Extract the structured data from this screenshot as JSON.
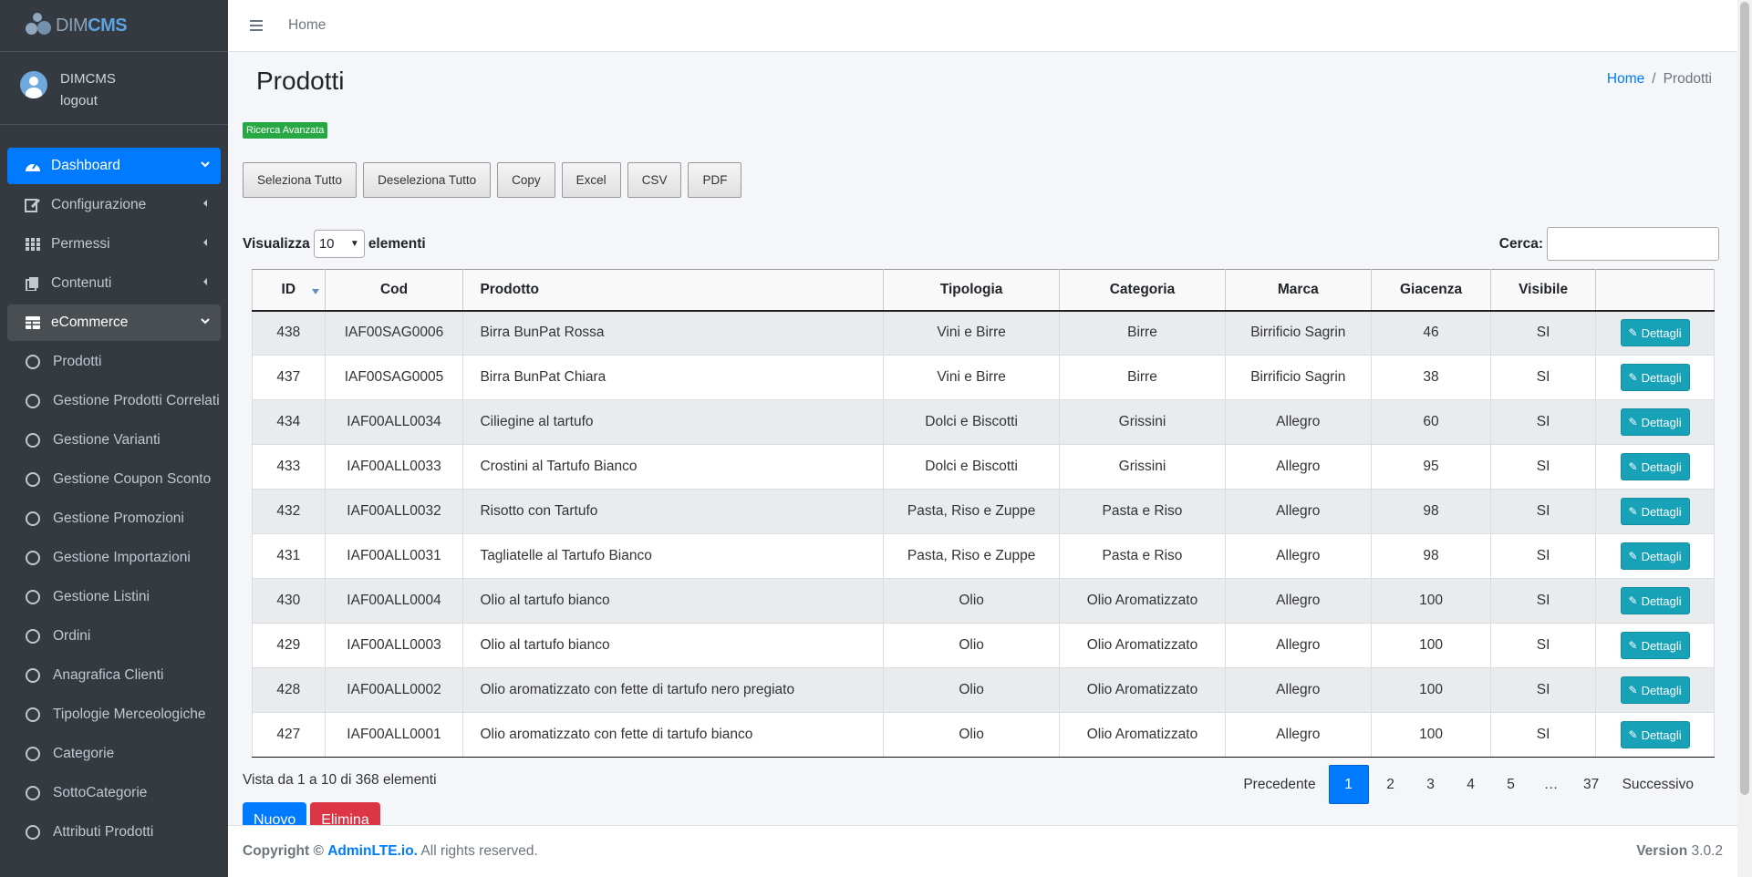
{
  "brand": {
    "dim": "DIM",
    "cms": "CMS"
  },
  "user": {
    "name": "DIMCMS",
    "logout": "logout"
  },
  "sidebar": {
    "main": [
      {
        "label": "Dashboard",
        "icon": "tachometer-icon",
        "arrow": "down",
        "state": "active"
      },
      {
        "label": "Configurazione",
        "icon": "edit-icon",
        "arrow": "left",
        "state": ""
      },
      {
        "label": "Permessi",
        "icon": "grid-icon",
        "arrow": "left",
        "state": ""
      },
      {
        "label": "Contenuti",
        "icon": "copy-icon",
        "arrow": "left",
        "state": ""
      },
      {
        "label": "eCommerce",
        "icon": "table-icon",
        "arrow": "down",
        "state": "open"
      }
    ],
    "sub": [
      "Prodotti",
      "Gestione Prodotti Correlati",
      "Gestione Varianti",
      "Gestione Coupon Sconto",
      "Gestione Promozioni",
      "Gestione Importazioni",
      "Gestione Listini",
      "Ordini",
      "Anagrafica Clienti",
      "Tipologie Merceologiche",
      "Categorie",
      "SottoCategorie",
      "Attributi Prodotti"
    ]
  },
  "topbar": {
    "home": "Home"
  },
  "page": {
    "title": "Prodotti",
    "breadcrumb_home": "Home",
    "breadcrumb_sep": "/",
    "breadcrumb_current": "Prodotti",
    "advanced_search": "Ricerca Avanzata"
  },
  "toolbar": {
    "select_all": "Seleziona Tutto",
    "deselect_all": "Deseleziona Tutto",
    "copy": "Copy",
    "excel": "Excel",
    "csv": "CSV",
    "pdf": "PDF"
  },
  "length": {
    "prefix": "Visualizza",
    "value": "10",
    "suffix": "elementi"
  },
  "search": {
    "label": "Cerca:",
    "value": ""
  },
  "table": {
    "headers": [
      "ID",
      "Cod",
      "Prodotto",
      "Tipologia",
      "Categoria",
      "Marca",
      "Giacenza",
      "Visibile",
      ""
    ],
    "action_label": "Dettagli",
    "rows": [
      [
        "438",
        "IAF00SAG0006",
        "Birra BunPat Rossa",
        "Vini e Birre",
        "Birre",
        "Birrificio Sagrin",
        "46",
        "SI"
      ],
      [
        "437",
        "IAF00SAG0005",
        "Birra BunPat Chiara",
        "Vini e Birre",
        "Birre",
        "Birrificio Sagrin",
        "38",
        "SI"
      ],
      [
        "434",
        "IAF00ALL0034",
        "Ciliegine al tartufo",
        "Dolci e Biscotti",
        "Grissini",
        "Allegro",
        "60",
        "SI"
      ],
      [
        "433",
        "IAF00ALL0033",
        "Crostini al Tartufo Bianco",
        "Dolci e Biscotti",
        "Grissini",
        "Allegro",
        "95",
        "SI"
      ],
      [
        "432",
        "IAF00ALL0032",
        "Risotto con Tartufo",
        "Pasta, Riso e Zuppe",
        "Pasta e Riso",
        "Allegro",
        "98",
        "SI"
      ],
      [
        "431",
        "IAF00ALL0031",
        "Tagliatelle al Tartufo Bianco",
        "Pasta, Riso e Zuppe",
        "Pasta e Riso",
        "Allegro",
        "98",
        "SI"
      ],
      [
        "430",
        "IAF00ALL0004",
        "Olio al tartufo bianco",
        "Olio",
        "Olio Aromatizzato",
        "Allegro",
        "100",
        "SI"
      ],
      [
        "429",
        "IAF00ALL0003",
        "Olio al tartufo bianco",
        "Olio",
        "Olio Aromatizzato",
        "Allegro",
        "100",
        "SI"
      ],
      [
        "428",
        "IAF00ALL0002",
        "Olio aromatizzato con fette di tartufo nero pregiato",
        "Olio",
        "Olio Aromatizzato",
        "Allegro",
        "100",
        "SI"
      ],
      [
        "427",
        "IAF00ALL0001",
        "Olio aromatizzato con fette di tartufo bianco",
        "Olio",
        "Olio Aromatizzato",
        "Allegro",
        "100",
        "SI"
      ]
    ]
  },
  "info": "Vista da 1 a 10 di 368 elementi",
  "pagination": {
    "prev": "Precedente",
    "pages": [
      "1",
      "2",
      "3",
      "4",
      "5",
      "…",
      "37"
    ],
    "current": "1",
    "next": "Successivo"
  },
  "actions": {
    "new": "Nuovo",
    "delete": "Elimina"
  },
  "footer": {
    "copyright": "Copyright ©",
    "link": "AdminLTE.io.",
    "rights": "All rights reserved.",
    "version_label": "Version",
    "version": "3.0.2"
  },
  "colors": {
    "primary": "#007bff",
    "info": "#17a2b8",
    "success": "#28a745",
    "danger": "#dc3545",
    "sidebar": "#343a40"
  }
}
